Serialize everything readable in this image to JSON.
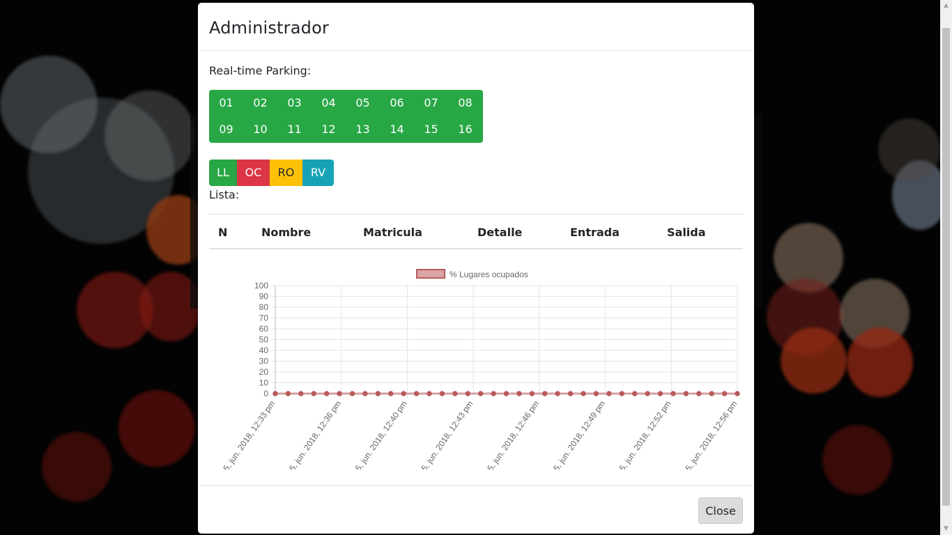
{
  "modal": {
    "title": "Administrador",
    "realtime_label": "Real-time Parking:",
    "spots_row1": [
      "01",
      "02",
      "03",
      "04",
      "05",
      "06",
      "07",
      "08"
    ],
    "spots_row2": [
      "09",
      "10",
      "11",
      "12",
      "13",
      "14",
      "15",
      "16"
    ],
    "status_buttons": [
      "LL",
      "OC",
      "RO",
      "RV"
    ],
    "list_label": "Lista:",
    "table_headers": [
      "N",
      "Nombre",
      "Matricula",
      "Detalle",
      "Entrada",
      "Salida"
    ],
    "close_label": "Close"
  },
  "colors": {
    "spot_free": "#28a745",
    "ll": "#28a745",
    "oc": "#dc3545",
    "ro": "#ffc107",
    "rv": "#17a2b8",
    "series": "#b85a5a"
  },
  "chart_data": {
    "type": "line",
    "legend": "% Lugares ocupados",
    "legend_position": "top-center",
    "grid": true,
    "ylim": [
      0,
      100
    ],
    "y_ticks": [
      0,
      10,
      20,
      30,
      40,
      50,
      60,
      70,
      80,
      90,
      100
    ],
    "x_tick_labels": [
      "5, jun. 2018, 12:33 pm",
      "5, jun. 2018, 12:36 pm",
      "5, jun. 2018, 12:40 pm",
      "5, jun. 2018, 12:43 pm",
      "5, jun. 2018, 12:46 pm",
      "5, jun. 2018, 12:49 pm",
      "5, jun. 2018, 12:52 pm",
      "5, jun. 2018, 12:56 pm"
    ],
    "series": [
      {
        "name": "% Lugares ocupados",
        "values": [
          0,
          0,
          0,
          0,
          0,
          0,
          0,
          0,
          0,
          0,
          0,
          0,
          0,
          0,
          0,
          0,
          0,
          0,
          0,
          0,
          0,
          0,
          0,
          0,
          0,
          0,
          0,
          0,
          0,
          0,
          0,
          0,
          0,
          0,
          0,
          0,
          0
        ]
      }
    ]
  }
}
